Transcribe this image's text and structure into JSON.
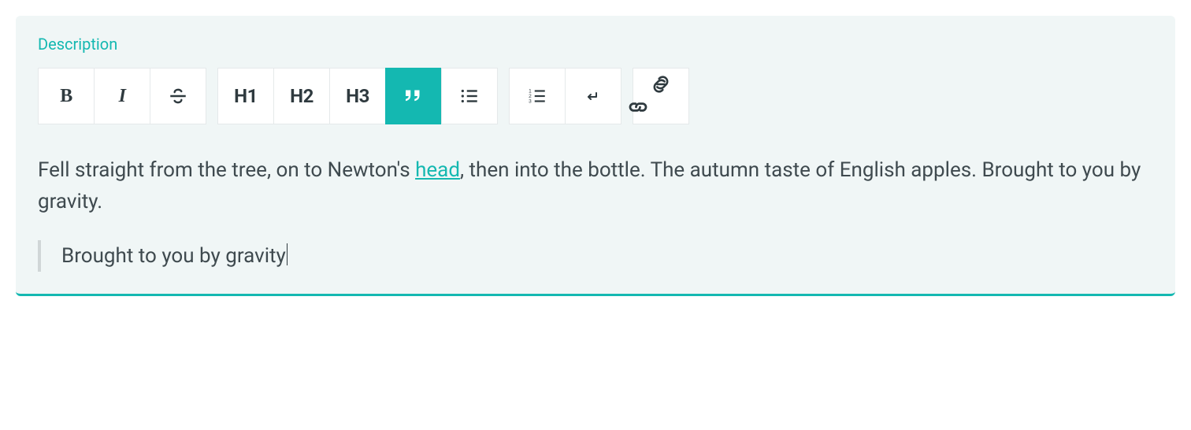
{
  "panel": {
    "label": "Description"
  },
  "toolbar": {
    "bold": "B",
    "italic": "I",
    "h1": "H1",
    "h2": "H2",
    "h3": "H3"
  },
  "content": {
    "paragraph_pre": "Fell straight from the tree, on to Newton's ",
    "link_text": "head",
    "paragraph_post": ", then into the bottle. The autumn taste of English apples. Brought to you by gravity.",
    "blockquote": "Brought to you by gravity"
  },
  "colors": {
    "accent": "#14b8b1",
    "panel_bg": "#f0f6f6",
    "text": "#3f4a4f"
  }
}
